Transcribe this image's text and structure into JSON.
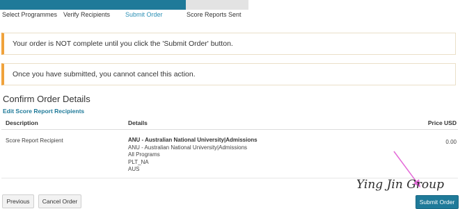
{
  "progress": {
    "steps": [
      {
        "label": "Select Programmes"
      },
      {
        "label": "Verify Recipients"
      },
      {
        "label": "Submit Order"
      },
      {
        "label": "Score Reports Sent"
      }
    ],
    "completed_fraction": 0.75
  },
  "alerts": {
    "incomplete": "Your order is NOT complete until you click the 'Submit Order' button.",
    "no_cancel": "Once you have submitted, you cannot cancel this action."
  },
  "confirm": {
    "title": "Confirm Order Details",
    "edit_link": "Edit Score Report Recipients",
    "columns": {
      "description": "Description",
      "details": "Details",
      "price": "Price USD"
    },
    "row": {
      "description": "Score Report Recipient",
      "details_title": "ANU - Australian National University|Admissions",
      "details_lines": [
        "ANU - Australian National University|Admissions",
        "All Programs",
        "PLT_NA",
        "AUS"
      ],
      "price": "0.00"
    }
  },
  "buttons": {
    "previous": "Previous",
    "cancel": "Cancel Order",
    "submit": "Submit Order"
  },
  "watermark": "Ying Jin Group",
  "colors": {
    "accent": "#1f7a99",
    "alert_border": "#f0a23b",
    "active_step": "#2a8fb4"
  }
}
